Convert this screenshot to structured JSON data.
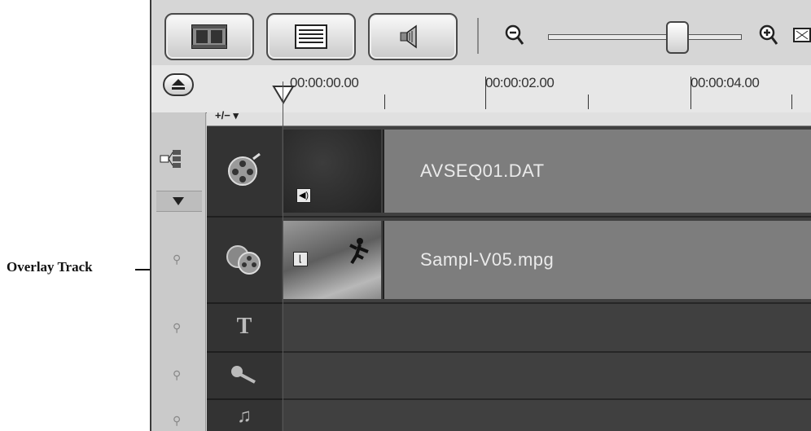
{
  "callout": {
    "label": "Overlay Track"
  },
  "ruler": {
    "timecodes": [
      "00:00:00.00",
      "00:00:02.00",
      "00:00:04.00"
    ]
  },
  "track_controls": {
    "add_remove": "+/− ▾"
  },
  "tracks": [
    {
      "name": "video-track",
      "icon": "film-reel-icon",
      "clip_name": "AVSEQ01.DAT",
      "badge_icon": "audio-speaker-icon"
    },
    {
      "name": "overlay-track",
      "icon": "overlay-reels-icon",
      "clip_name": "Sampl-V05.mpg",
      "badge_icon": "overlay-frame-icon"
    },
    {
      "name": "title-track",
      "icon": "title-t-icon"
    },
    {
      "name": "voice-track",
      "icon": "microphone-icon"
    },
    {
      "name": "music-track",
      "icon": "music-note-icon"
    }
  ],
  "colors": {
    "track_bg": "#404040",
    "clip_bg": "#7d7d7d",
    "header_bg": "#333333"
  }
}
